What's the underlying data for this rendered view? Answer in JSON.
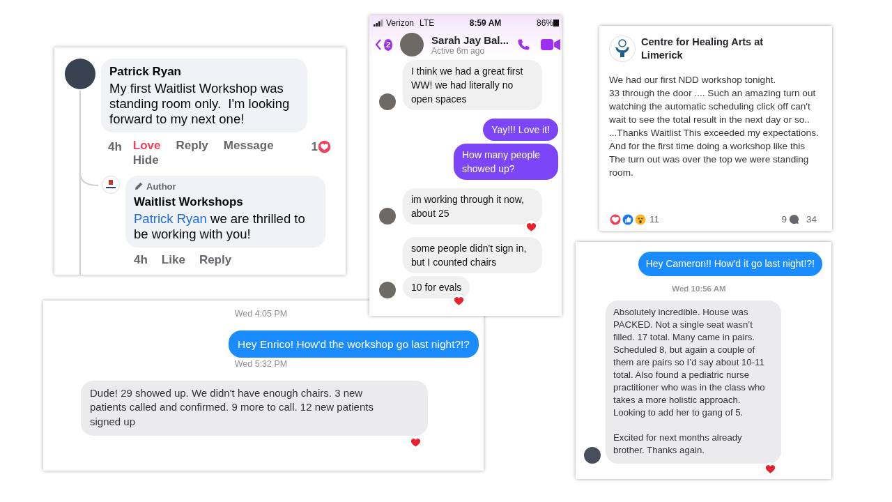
{
  "comment_thread": {
    "comment": {
      "author": "Patrick Ryan",
      "text": "My first Waitlist Workshop was standing room only.  I'm looking forward to my next one!",
      "time": "4h",
      "actions": [
        {
          "label": "Love",
          "active": true
        },
        {
          "label": "Reply",
          "active": false
        },
        {
          "label": "Message",
          "active": false
        },
        {
          "label": "Hide",
          "active": false
        }
      ],
      "reaction_count": "1"
    },
    "reply": {
      "badge": "Author",
      "author": "Waitlist Workshops",
      "mention": "Patrick Ryan",
      "text": " we are thrilled to be working with you!",
      "time": "4h",
      "actions": [
        {
          "label": "Like",
          "active": false
        },
        {
          "label": "Reply",
          "active": false
        }
      ]
    }
  },
  "messenger_chat": {
    "status_bar": {
      "carrier": "Verizon",
      "network": "LTE",
      "time": "8:59 AM",
      "battery": "86%"
    },
    "header": {
      "unread_count": "2",
      "contact": "Sarah Jay Bal...",
      "presence": "Active 6m ago"
    },
    "messages": [
      {
        "kind": "received",
        "text": "I think we had a great first WW! we had literally no open spaces",
        "avatar": true,
        "hearted": false
      },
      {
        "kind": "sent",
        "text": "Yay!!! Love it!"
      },
      {
        "kind": "sent",
        "text": "How many people showed up?"
      },
      {
        "kind": "received",
        "text": "im working through it now, about 25",
        "avatar": true,
        "hearted": true
      },
      {
        "kind": "received",
        "text": "some people didn't sign in, but I counted chairs",
        "avatar": false,
        "hearted": false
      },
      {
        "kind": "received",
        "text": "10 for evals",
        "avatar": true,
        "hearted": true
      }
    ]
  },
  "page_post": {
    "page_name": "Centre for Healing Arts at Limerick",
    "text": "We had our first NDD workshop tonight.\n33 through the door .... Such an amazing turn out watching the automatic scheduling click off can't wait to see the total result in the next day or so.. ...Thanks Waitlist This exceeded my expectations. And for the first time doing a workshop like this\nThe turn out was over the top we were standing room.",
    "reaction_count": "11",
    "comment_count": "9",
    "share_count": "34"
  },
  "imessage_enrico": {
    "items": [
      {
        "kind": "timestamp",
        "text": "Wed 4:05 PM"
      },
      {
        "kind": "sent",
        "text": "Hey Enrico! How'd the workshop go last night?!?"
      },
      {
        "kind": "timestamp",
        "text": "Wed 5:32 PM"
      },
      {
        "kind": "received",
        "text": "Dude! 29 showed up. We didn't have enough chairs. 3 new patients called and confirmed. 9 more to call. 12 new patients signed up",
        "avatar": false,
        "hearted": true
      }
    ]
  },
  "imessage_cameron": {
    "items": [
      {
        "kind": "sent",
        "text": "Hey Cameron!! How'd it go last night!?!"
      },
      {
        "kind": "timestamp",
        "text": "Wed 10:56 AM"
      },
      {
        "kind": "received",
        "text": "Absolutely incredible. House was PACKED. Not a single seat wasn’t filled. 17 total. Many came in pairs. Scheduled 8, but again a couple of them are pairs so I’d say about 10-11 total. Also found a pediatric nurse practitioner who was in the class who takes a more holistic approach. Looking to add her to gang of 5.\n\nExcited for next months already brother. Thanks again.",
        "avatar": true,
        "hearted": true
      }
    ]
  }
}
